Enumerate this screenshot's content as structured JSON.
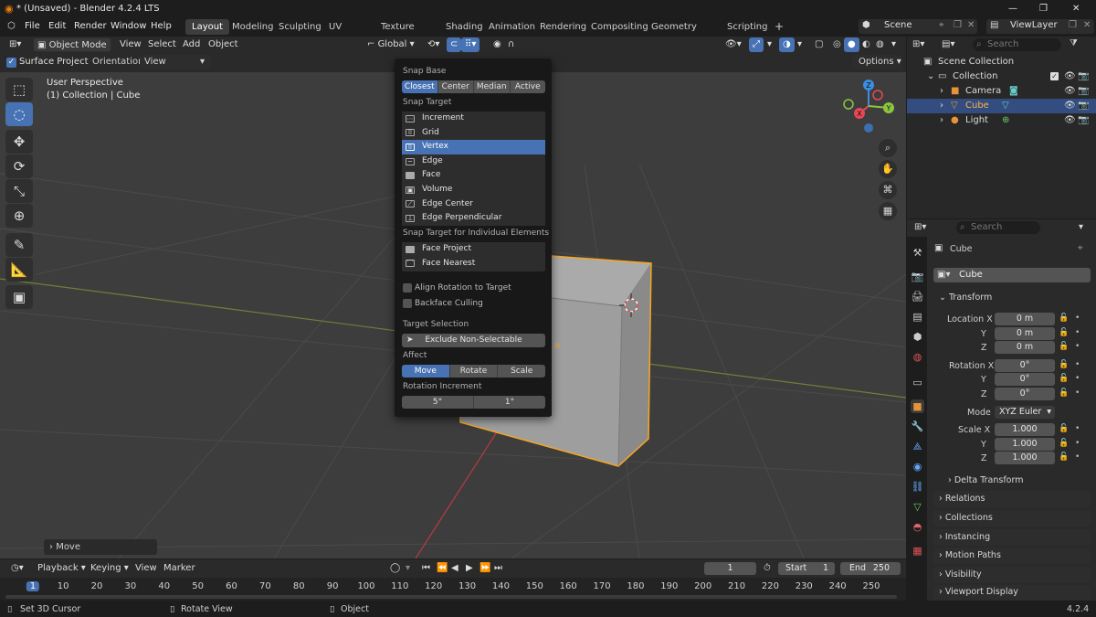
{
  "window": {
    "title": "* (Unsaved) - Blender 4.2.4 LTS",
    "minimize": "—",
    "maximize": "❐",
    "close": "✕"
  },
  "menu": {
    "file": "File",
    "edit": "Edit",
    "render": "Render",
    "window": "Window",
    "help": "Help"
  },
  "workspaces": [
    "Layout",
    "Modeling",
    "Sculpting",
    "UV Editing",
    "Texture Paint",
    "Shading",
    "Animation",
    "Rendering",
    "Compositing",
    "Geometry Nodes",
    "Scripting"
  ],
  "scene": {
    "name": "Scene",
    "view_layer": "ViewLayer"
  },
  "viewport_header": {
    "mode": "Object Mode",
    "view": "View",
    "select": "Select",
    "add": "Add",
    "object": "Object",
    "transform_orientation": "Global"
  },
  "tool_header": {
    "surface_project": "Surface Project",
    "orientation_label": "Orientation:",
    "orientation_value": "View",
    "options": "Options"
  },
  "viewport": {
    "perspective": "User Perspective",
    "collection_object": "(1) Collection | Cube",
    "last_op": "Move"
  },
  "snap_popup": {
    "snap_base_label": "Snap Base",
    "snap_base": [
      "Closest",
      "Center",
      "Median",
      "Active"
    ],
    "snap_base_active": "Closest",
    "snap_target_label": "Snap Target",
    "snap_targets": [
      "Increment",
      "Grid",
      "Vertex",
      "Edge",
      "Face",
      "Volume",
      "Edge Center",
      "Edge Perpendicular"
    ],
    "snap_target_active": "Vertex",
    "individual_label": "Snap Target for Individual Elements",
    "individual": [
      "Face Project",
      "Face Nearest"
    ],
    "align_rotation": "Align Rotation to Target",
    "backface_culling": "Backface Culling",
    "target_selection_label": "Target Selection",
    "target_selection": "Exclude Non-Selectable",
    "affect_label": "Affect",
    "affect": [
      "Move",
      "Rotate",
      "Scale"
    ],
    "affect_active": "Move",
    "rotation_increment_label": "Rotation Increment",
    "rotation_increment": [
      "5°",
      "1°"
    ]
  },
  "outliner": {
    "search_placeholder": "Search",
    "scene_collection": "Scene Collection",
    "collection": "Collection",
    "items": [
      "Camera",
      "Cube",
      "Light"
    ],
    "selected": "Cube"
  },
  "properties": {
    "search_placeholder": "Search",
    "object_name": "Cube",
    "object_data_name": "Cube",
    "transform_label": "Transform",
    "location_label": "Location X",
    "location": [
      "0 m",
      "0 m",
      "0 m"
    ],
    "rotation_label": "Rotation X",
    "rotation": [
      "0°",
      "0°",
      "0°"
    ],
    "mode_label": "Mode",
    "mode_value": "XYZ Euler",
    "scale_label": "Scale X",
    "scale": [
      "1.000",
      "1.000",
      "1.000"
    ],
    "y": "Y",
    "z": "Z",
    "panels": [
      "Delta Transform",
      "Relations",
      "Collections",
      "Instancing",
      "Motion Paths",
      "Visibility",
      "Viewport Display"
    ]
  },
  "timeline": {
    "playback": "Playback",
    "keying": "Keying",
    "view": "View",
    "marker": "Marker",
    "current_frame": "1",
    "start_label": "Start",
    "start": "1",
    "end_label": "End",
    "end": "250",
    "ticks": [
      "1",
      "10",
      "20",
      "30",
      "40",
      "50",
      "60",
      "70",
      "80",
      "90",
      "100",
      "110",
      "120",
      "130",
      "140",
      "150",
      "160",
      "170",
      "180",
      "190",
      "200",
      "210",
      "220",
      "230",
      "240",
      "250"
    ]
  },
  "statusbar": {
    "left": "Set 3D Cursor",
    "middle": "Rotate View",
    "right": "Object",
    "version": "4.2.4"
  },
  "colors": {
    "accent": "#4772b3",
    "selection_outline": "#f5a623",
    "axis_x": "#e84856",
    "axis_y": "#8cc63f",
    "axis_z": "#3d8de0"
  }
}
